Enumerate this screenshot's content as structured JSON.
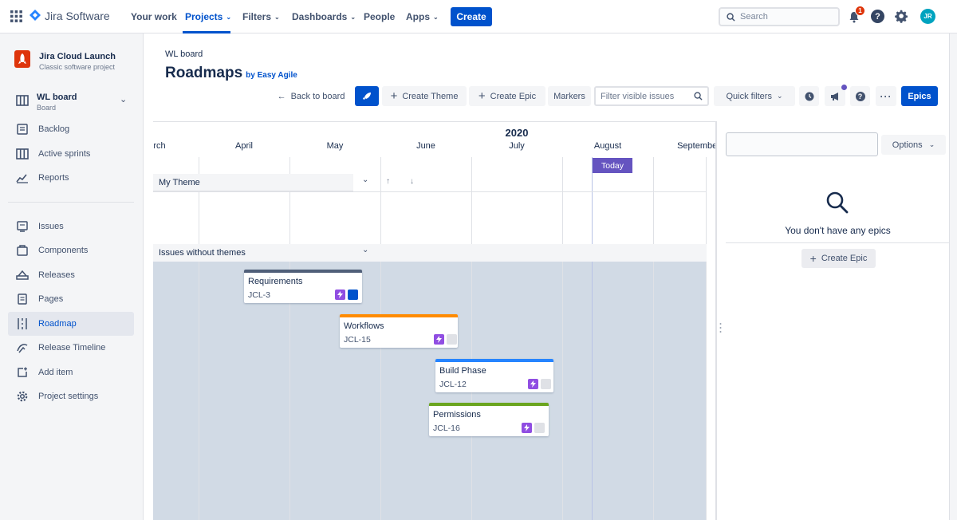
{
  "topnav": {
    "product": "Jira Software",
    "items": [
      {
        "label": "Your work",
        "dropdown": false
      },
      {
        "label": "Projects",
        "dropdown": true,
        "active": true
      },
      {
        "label": "Filters",
        "dropdown": true
      },
      {
        "label": "Dashboards",
        "dropdown": true
      },
      {
        "label": "People",
        "dropdown": false
      },
      {
        "label": "Apps",
        "dropdown": true
      }
    ],
    "create_label": "Create",
    "search_placeholder": "Search",
    "notification_count": "1",
    "avatar_initials": "JR"
  },
  "sidebar": {
    "project_name": "Jira Cloud Launch",
    "project_type": "Classic software project",
    "board_name": "WL board",
    "board_type": "Board",
    "items": [
      {
        "label": "Backlog",
        "icon": "backlog-icon"
      },
      {
        "label": "Active sprints",
        "icon": "sprints-icon"
      },
      {
        "label": "Reports",
        "icon": "reports-icon"
      },
      {
        "label": "Issues",
        "icon": "issues-icon"
      },
      {
        "label": "Components",
        "icon": "components-icon"
      },
      {
        "label": "Releases",
        "icon": "releases-icon"
      },
      {
        "label": "Pages",
        "icon": "pages-icon"
      },
      {
        "label": "Roadmap",
        "icon": "roadmap-icon",
        "active": true
      },
      {
        "label": "Release Timeline",
        "icon": "release-timeline-icon"
      },
      {
        "label": "Add item",
        "icon": "add-item-icon"
      },
      {
        "label": "Project settings",
        "icon": "gear-icon"
      }
    ]
  },
  "header": {
    "breadcrumb": "WL board",
    "title": "Roadmaps",
    "by_label": "by Easy Agile"
  },
  "toolbar": {
    "back_label": "Back to board",
    "create_theme_label": "Create Theme",
    "create_epic_label": "Create Epic",
    "markers_label": "Markers",
    "filter_placeholder": "Filter visible issues",
    "quick_filters_label": "Quick filters",
    "epics_label": "Epics"
  },
  "timeline": {
    "year": "2020",
    "months": [
      "rch",
      "April",
      "May",
      "June",
      "July",
      "August",
      "September"
    ],
    "today_label": "Today",
    "theme_label": "My Theme",
    "no_theme_label": "Issues without themes",
    "cards": [
      {
        "title": "Requirements",
        "key": "JCL-3",
        "bar_color": "#505f79",
        "sq_color": "#0052cc"
      },
      {
        "title": "Workflows",
        "key": "JCL-15",
        "bar_color": "#ff8b00",
        "sq_color": "#dfe1e6"
      },
      {
        "title": "Build Phase",
        "key": "JCL-12",
        "bar_color": "#2684ff",
        "sq_color": "#dfe1e6"
      },
      {
        "title": "Permissions",
        "key": "JCL-16",
        "bar_color": "#6aa51f",
        "sq_color": "#dfe1e6"
      }
    ]
  },
  "rpanel": {
    "options_label": "Options",
    "empty_text": "You don't have any epics",
    "create_epic_label": "Create Epic"
  }
}
